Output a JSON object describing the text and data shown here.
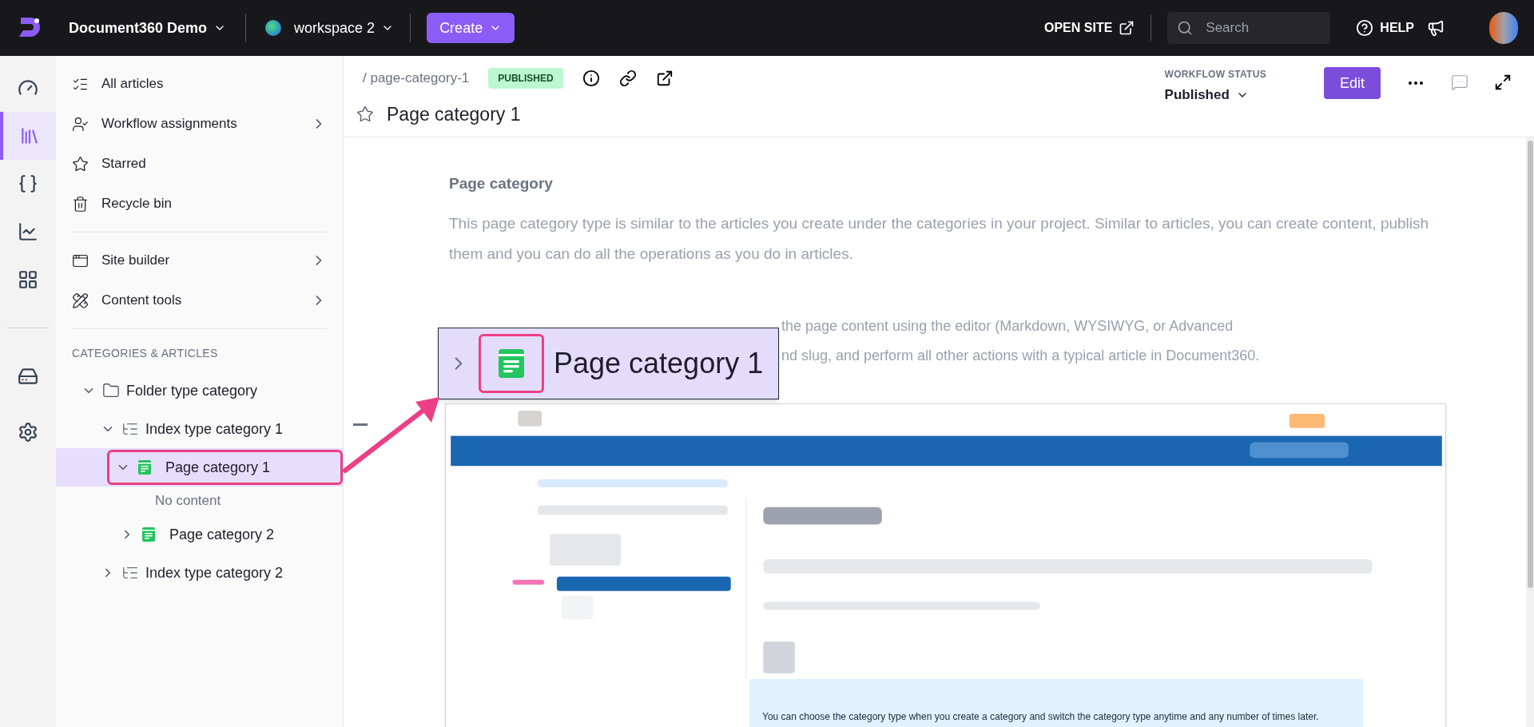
{
  "topbar": {
    "project": "Document360 Demo",
    "workspace": "workspace 2",
    "create": "Create",
    "open_site": "OPEN SITE",
    "search_placeholder": "Search",
    "help": "HELP"
  },
  "rail": [
    {
      "kind": "dashboard",
      "selected": false
    },
    {
      "kind": "docs",
      "selected": true
    },
    {
      "kind": "api",
      "selected": false
    },
    {
      "kind": "analytics",
      "selected": false
    },
    {
      "kind": "apps",
      "selected": false
    },
    {
      "kind": "drive",
      "selected": false
    },
    {
      "kind": "settings",
      "selected": false
    }
  ],
  "sidebar": {
    "nav": [
      {
        "kind": "all",
        "label": "All articles",
        "submenu": false
      },
      {
        "kind": "workflow",
        "label": "Workflow assignments",
        "submenu": true
      },
      {
        "kind": "starred",
        "label": "Starred",
        "submenu": false
      },
      {
        "kind": "recycle",
        "label": "Recycle bin",
        "submenu": false
      },
      {
        "kind": "site",
        "label": "Site builder",
        "submenu": true
      },
      {
        "kind": "tools",
        "label": "Content tools",
        "submenu": true
      }
    ],
    "section_title": "CATEGORIES & ARTICLES",
    "tree": [
      {
        "kind": "folder",
        "label": "Folder type category",
        "expanded": true,
        "selected": false,
        "children": [
          {
            "kind": "index",
            "label": "Index type category 1",
            "expanded": true,
            "selected": false,
            "children": [
              {
                "kind": "page",
                "label": "Page category 1",
                "expanded": true,
                "selected": true,
                "children": [
                  {
                    "kind": "empty",
                    "label": "No content"
                  }
                ]
              },
              {
                "kind": "page",
                "label": "Page category 2",
                "expanded": false,
                "selected": false
              }
            ]
          },
          {
            "kind": "index",
            "label": "Index type category 2",
            "expanded": false,
            "selected": false
          }
        ]
      }
    ]
  },
  "article": {
    "slug": "/ page-category-1",
    "status": "PUBLISHED",
    "workflow_label": "WORKFLOW STATUS",
    "workflow_value": "Published",
    "edit": "Edit",
    "title": "Page category 1",
    "starred": false
  },
  "body": {
    "heading": "Page category",
    "paragraph": "This page category type is similar to the articles you create under the categories in your project. Similar to articles, you can create content, publish them and you can do all the operations as you do in articles.",
    "lines": [
      "the page content using the editor (Markdown, WYSIWYG, or Advanced",
      "nd slug, and perform all other actions with a typical article in Document360."
    ],
    "embedded_note": "You can choose the category type when you create a category and switch the category type anytime and any number of times later."
  },
  "callout": {
    "label": "Page category 1"
  }
}
